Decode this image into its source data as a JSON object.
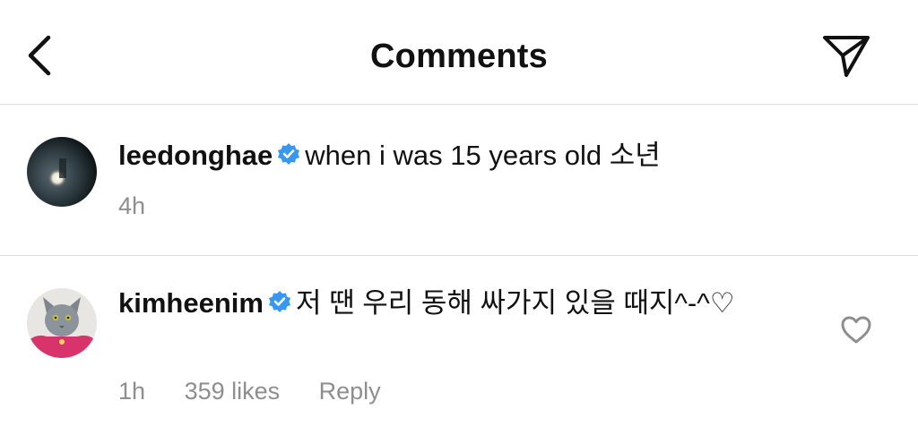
{
  "header": {
    "title": "Comments",
    "back_icon": "chevron-left-icon",
    "share_icon": "paper-plane-icon"
  },
  "comments": [
    {
      "username": "leedonghae",
      "verified": true,
      "text": "when i was 15 years old 소년",
      "time": "4h"
    },
    {
      "username": "kimheenim",
      "verified": true,
      "text": "저 땐 우리 동해 싸가지 있을 때지^-^♡",
      "time": "1h",
      "likes": "359 likes",
      "reply_label": "Reply",
      "like_icon": "heart-outline-icon"
    }
  ],
  "colors": {
    "verified_blue": "#3897f0",
    "meta_gray": "#8e8e8e",
    "divider": "#dcdcdc"
  }
}
